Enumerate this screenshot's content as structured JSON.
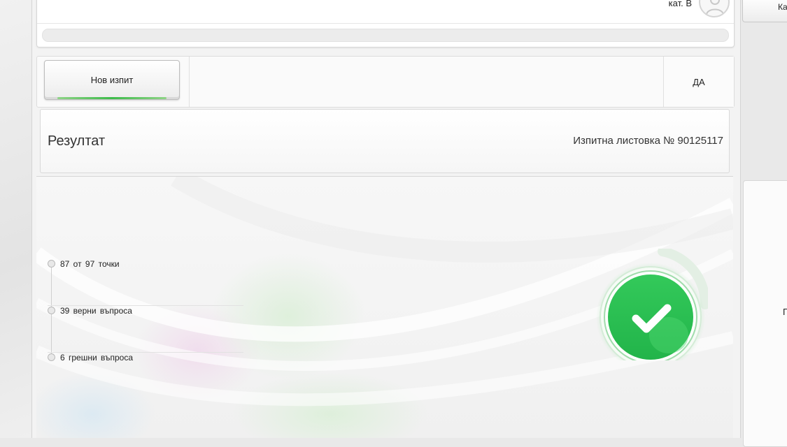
{
  "header": {
    "category_label": "кат. B",
    "right_button_label": "Ка"
  },
  "toolbar": {
    "new_exam_label": "Нов изпит",
    "yes_label": "ДА"
  },
  "result": {
    "title": "Резултат",
    "sheet_number": "Изпитна листовка № 90125117"
  },
  "stats": [
    {
      "text": "87  от  97  точки"
    },
    {
      "text": "39  верни въпроса"
    },
    {
      "text": "6  грешни въпроса"
    }
  ],
  "status": {
    "passed": true,
    "icon": "check-icon",
    "color": "#2cc152"
  },
  "right_panel": {
    "partial_label": "П"
  },
  "colors": {
    "accent_green": "#3dbb4a",
    "success_green": "#2cc152"
  }
}
